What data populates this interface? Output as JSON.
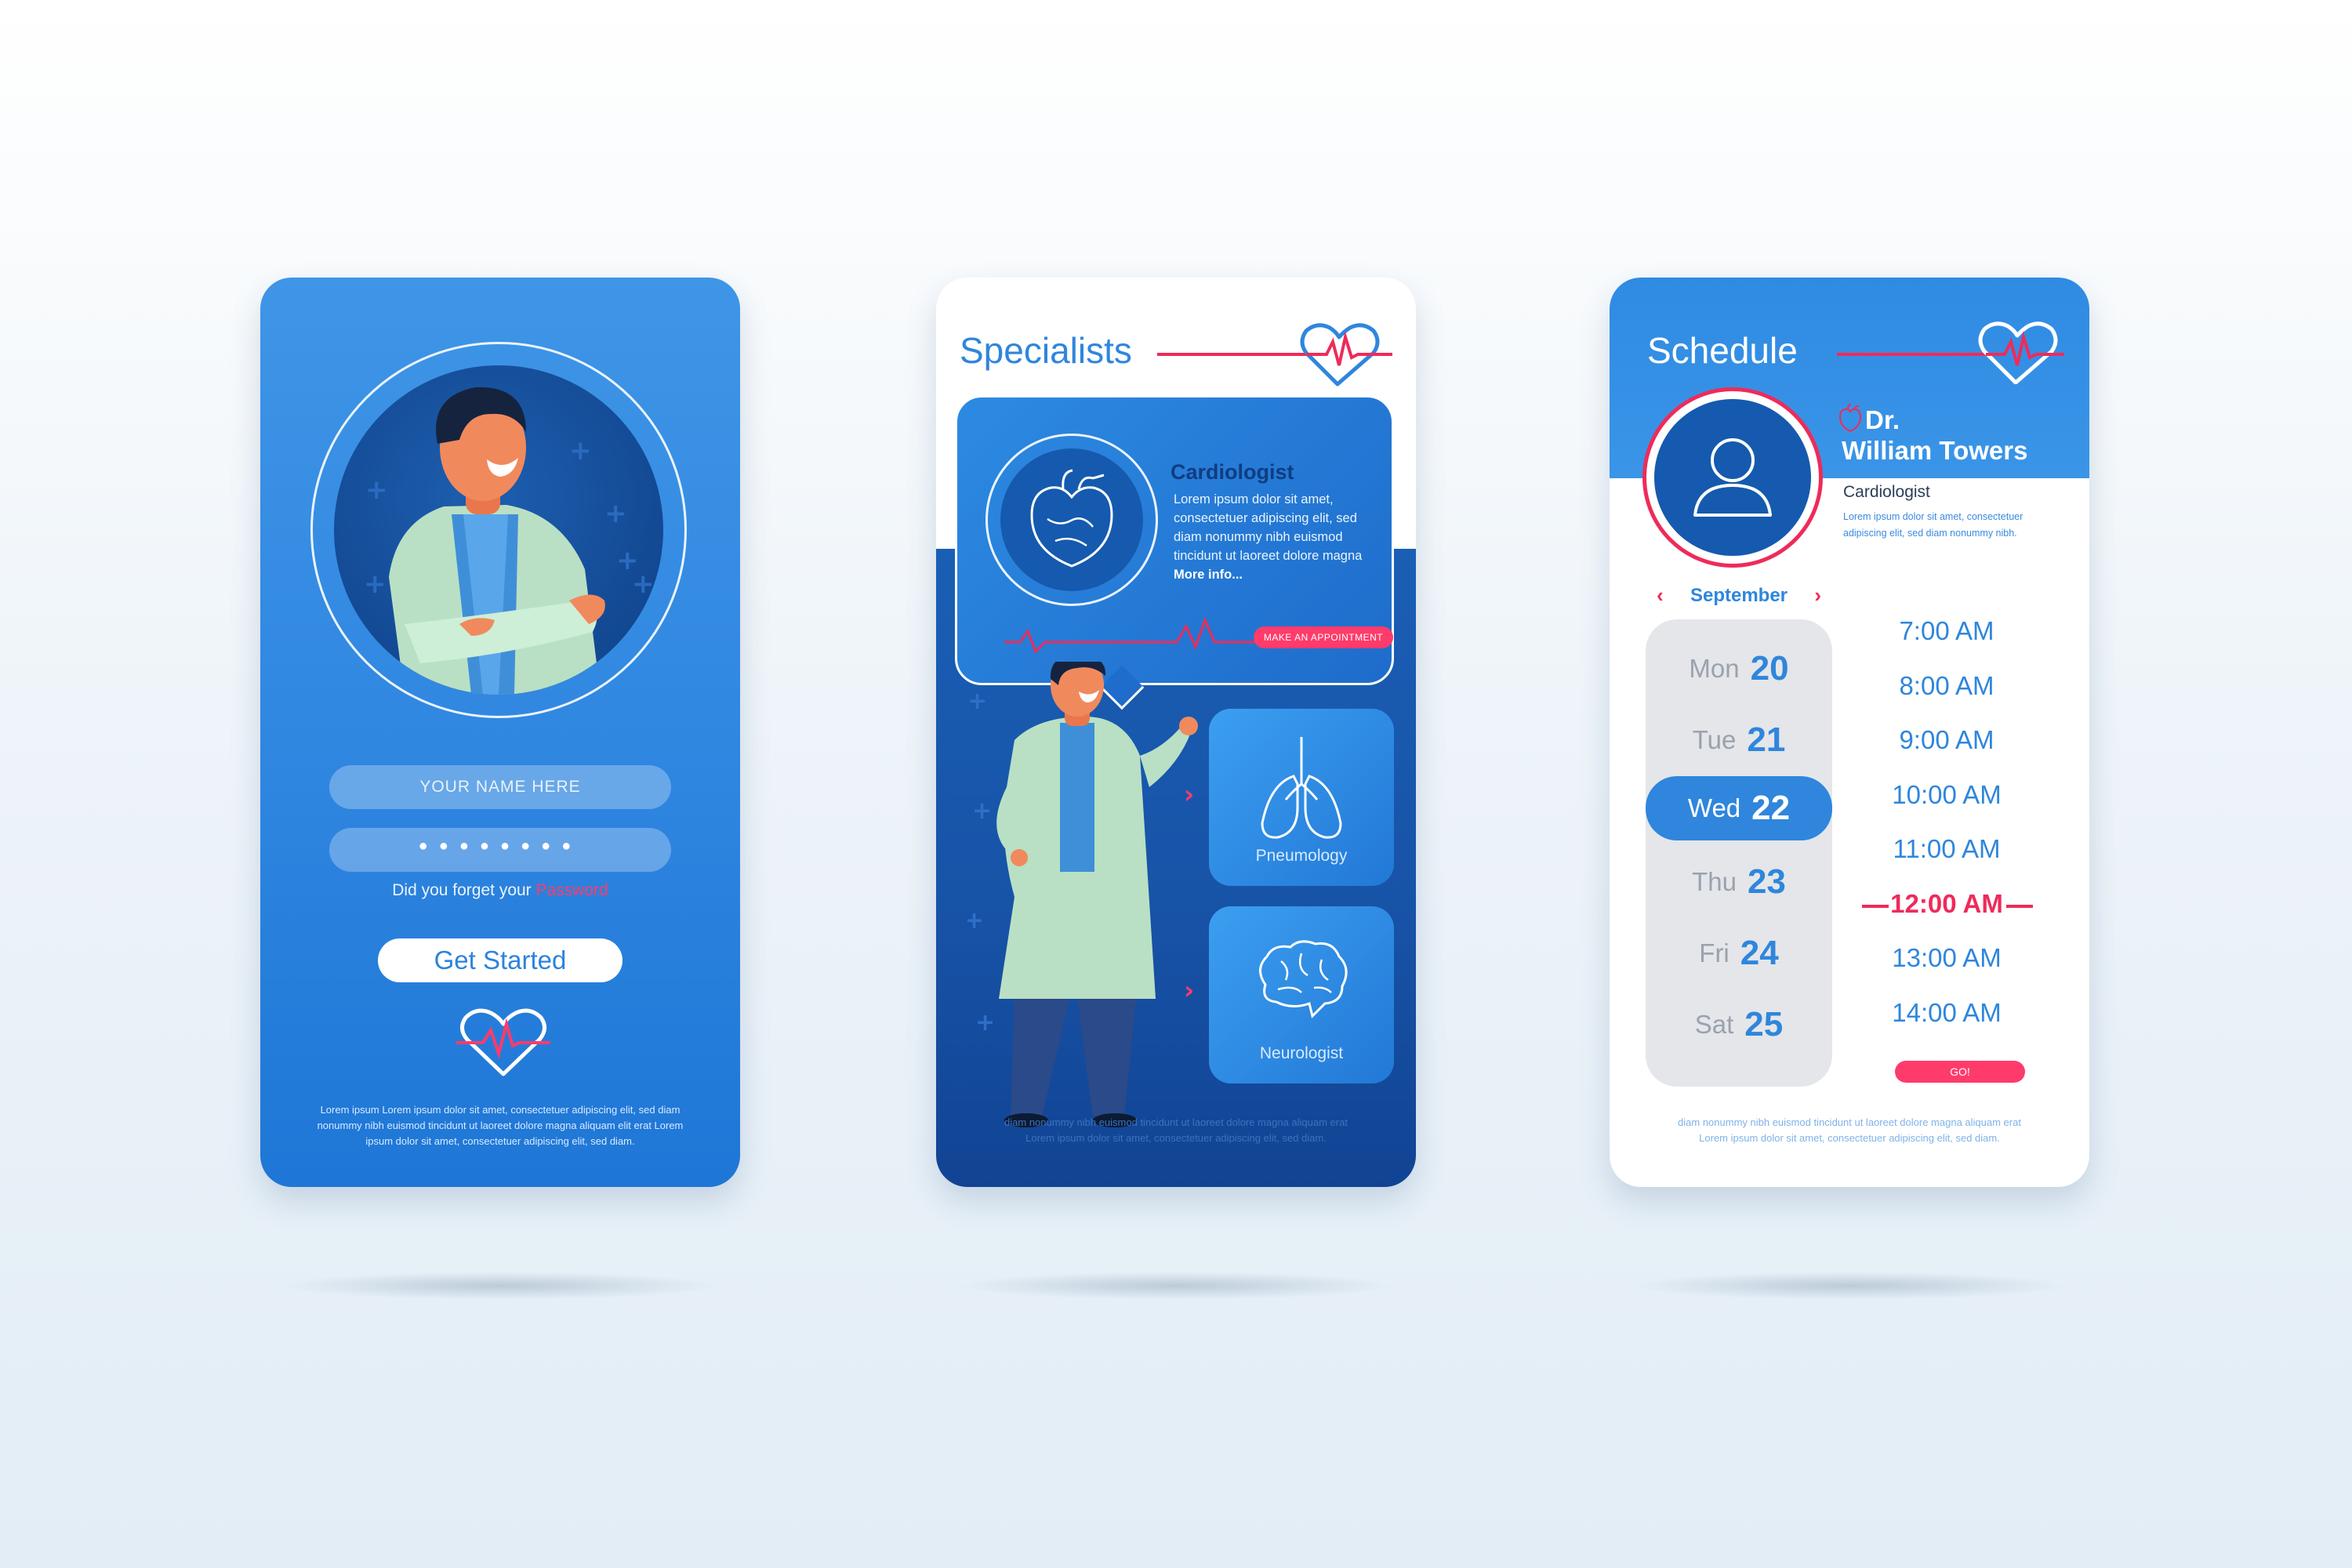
{
  "login": {
    "name_placeholder": "YOUR NAME HERE",
    "password_mask": "●●●●●●●●",
    "forgot_text": "Did you forget your",
    "forgot_link": "Password",
    "cta_label": "Get Started",
    "footer": "Lorem ipsum Lorem ipsum dolor sit amet, consectetuer adipiscing elit, sed diam nonummy nibh euismod tincidunt ut laoreet dolore magna aliquam elit erat Lorem ipsum dolor sit amet, consectetuer adipiscing elit, sed diam."
  },
  "specialists": {
    "title": "Specialists",
    "featured": {
      "name": "Cardiologist",
      "description": "Lorem ipsum dolor sit amet, consectetuer adipiscing elit, sed diam nonummy nibh euismod tincidunt ut laoreet dolore magna",
      "more": "More info...",
      "cta": "MAKE AN APPOINTMENT"
    },
    "tiles": [
      {
        "label": "Pneumology",
        "icon": "lungs-icon"
      },
      {
        "label": "Neurologist",
        "icon": "brain-icon"
      }
    ],
    "footer": "diam nonummy nibh euismod tincidunt ut laoreet dolore magna aliquam erat Lorem ipsum dolor sit amet, consectetuer adipiscing elit, sed diam."
  },
  "schedule": {
    "title": "Schedule",
    "doctor_prefix": "Dr.",
    "doctor_name": "William Towers",
    "doctor_role": "Cardiologist",
    "doctor_bio": "Lorem ipsum dolor sit amet, consectetuer adipiscing elit, sed diam nonummy nibh.",
    "month": "September",
    "days": [
      {
        "name": "Mon",
        "date": "20",
        "selected": false
      },
      {
        "name": "Tue",
        "date": "21",
        "selected": false
      },
      {
        "name": "Wed",
        "date": "22",
        "selected": true
      },
      {
        "name": "Thu",
        "date": "23",
        "selected": false
      },
      {
        "name": "Fri",
        "date": "24",
        "selected": false
      },
      {
        "name": "Sat",
        "date": "25",
        "selected": false
      }
    ],
    "times": [
      "7:00 AM",
      "8:00 AM",
      "9:00 AM",
      "10:00 AM",
      "11:00 AM",
      "12:00 AM",
      "13:00 AM",
      "14:00 AM"
    ],
    "selected_time": "12:00 AM",
    "go_label": "GO!",
    "footer": "diam nonummy nibh euismod tincidunt ut laoreet dolore magna aliquam erat Lorem ipsum dolor sit amet, consectetuer adipiscing elit, sed diam."
  },
  "colors": {
    "primary_blue": "#2f86dc",
    "accent_red": "#ff3b6b",
    "dark_blue": "#1752a6"
  }
}
